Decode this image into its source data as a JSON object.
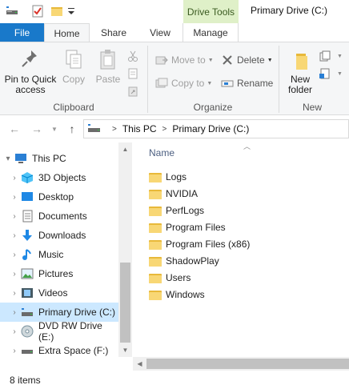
{
  "window": {
    "title": "Primary Drive (C:)",
    "contextual_tab_group": "Drive Tools"
  },
  "quick_access_toolbar": {
    "icons": [
      "drive-icon",
      "properties-check-icon",
      "new-folder-icon",
      "customize-dropdown-icon"
    ]
  },
  "tabs": [
    {
      "label": "File",
      "active": false
    },
    {
      "label": "Home",
      "active": true
    },
    {
      "label": "Share",
      "active": false
    },
    {
      "label": "View",
      "active": false
    },
    {
      "label": "Manage",
      "active": false
    }
  ],
  "ribbon": {
    "clipboard": {
      "label": "Clipboard",
      "pin_to_quick_access": "Pin to Quick access",
      "copy": "Copy",
      "paste": "Paste"
    },
    "organize": {
      "label": "Organize",
      "move_to": "Move to",
      "copy_to": "Copy to",
      "delete": "Delete",
      "rename": "Rename"
    },
    "new": {
      "label": "New",
      "new_folder": "New folder"
    }
  },
  "address_bar": {
    "breadcrumbs": [
      "This PC",
      "Primary Drive (C:)"
    ]
  },
  "navigation_pane": {
    "items": [
      {
        "label": "This PC",
        "icon": "pc-icon",
        "level": 0,
        "selected": false
      },
      {
        "label": "3D Objects",
        "icon": "3d-objects-icon",
        "level": 1,
        "selected": false
      },
      {
        "label": "Desktop",
        "icon": "desktop-icon",
        "level": 1,
        "selected": false
      },
      {
        "label": "Documents",
        "icon": "documents-icon",
        "level": 1,
        "selected": false
      },
      {
        "label": "Downloads",
        "icon": "downloads-icon",
        "level": 1,
        "selected": false
      },
      {
        "label": "Music",
        "icon": "music-icon",
        "level": 1,
        "selected": false
      },
      {
        "label": "Pictures",
        "icon": "pictures-icon",
        "level": 1,
        "selected": false
      },
      {
        "label": "Videos",
        "icon": "videos-icon",
        "level": 1,
        "selected": false
      },
      {
        "label": "Primary Drive (C:)",
        "icon": "drive-icon",
        "level": 1,
        "selected": true
      },
      {
        "label": "DVD RW Drive (E:)",
        "icon": "dvd-icon",
        "level": 1,
        "selected": false
      },
      {
        "label": "Extra Space (F:)",
        "icon": "drive-icon",
        "level": 1,
        "selected": false
      }
    ]
  },
  "content": {
    "column_header": "Name",
    "files": [
      {
        "name": "Logs",
        "type": "folder"
      },
      {
        "name": "NVIDIA",
        "type": "folder"
      },
      {
        "name": "PerfLogs",
        "type": "folder"
      },
      {
        "name": "Program Files",
        "type": "folder"
      },
      {
        "name": "Program Files (x86)",
        "type": "folder"
      },
      {
        "name": "ShadowPlay",
        "type": "folder"
      },
      {
        "name": "Users",
        "type": "folder"
      },
      {
        "name": "Windows",
        "type": "folder"
      }
    ]
  },
  "status_bar": {
    "item_count": "8 items"
  },
  "colors": {
    "file_tab": "#1979ca",
    "contextual_tab": "#dff0c8",
    "selection": "#cce8ff",
    "folder": "#f8d775"
  }
}
